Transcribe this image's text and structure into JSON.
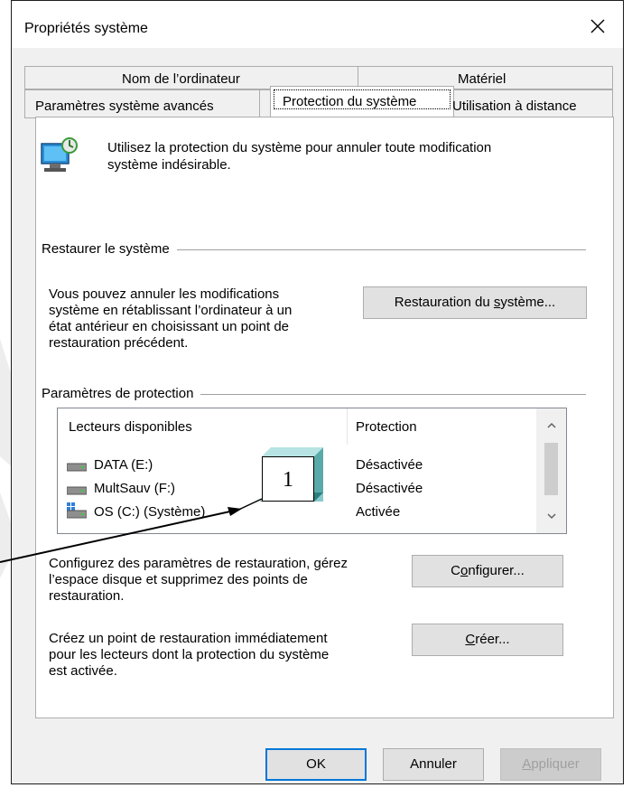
{
  "window": {
    "title": "Propriétés système",
    "close_glyph": "✕"
  },
  "tabs": {
    "row_back": [
      {
        "label": "Nom de l’ordinateur"
      },
      {
        "label": "Matériel"
      }
    ],
    "row_front": [
      {
        "label": "Paramètres système avancés"
      },
      {
        "label": "Protection du système",
        "active": true
      },
      {
        "label": "Utilisation à distance"
      }
    ]
  },
  "intro": {
    "icon": "system-protection-icon",
    "text_line1": "Utilisez la protection du système pour annuler toute modification",
    "text_line2": "système indésirable."
  },
  "restore": {
    "group_title": "Restaurer le système",
    "desc_line1": "Vous pouvez annuler les modifications",
    "desc_line2": "système en rétablissant l’ordinateur à un",
    "desc_line3": "état antérieur en choisissant un point de",
    "desc_line4": "restauration précédent.",
    "button_pre": "Restauration du ",
    "button_u": "s",
    "button_post": "ystème..."
  },
  "protection": {
    "group_title": "Paramètres de protection",
    "columns": {
      "drives": "Lecteurs disponibles",
      "protection": "Protection"
    },
    "drives": [
      {
        "name": "DATA (E:)",
        "status": "Désactivée",
        "icon": "drive-icon"
      },
      {
        "name": "MultSauv (F:)",
        "status": "Désactivée",
        "icon": "drive-icon"
      },
      {
        "name": "OS (C:) (Système)",
        "status": "Activée",
        "icon": "system-drive-icon"
      }
    ],
    "configure_desc_line1": "Configurez des paramètres de restauration, gérez",
    "configure_desc_line2": "l’espace disque et supprimez des points de",
    "configure_desc_line3": "restauration.",
    "configure_pre": "C",
    "configure_u": "o",
    "configure_post": "nfigurer...",
    "create_desc_line1": "Créez un point de restauration immédiatement",
    "create_desc_line2": "pour les lecteurs dont la protection du système",
    "create_desc_line3": "est activée.",
    "create_u": "C",
    "create_post": "réer..."
  },
  "footer": {
    "ok": "OK",
    "cancel": "Annuler",
    "apply_u": "A",
    "apply_post": "ppliquer"
  },
  "annotation": {
    "callout_number": "1"
  },
  "colors": {
    "accent": "#0078d7",
    "disabled_text": "#a0a0a0"
  }
}
